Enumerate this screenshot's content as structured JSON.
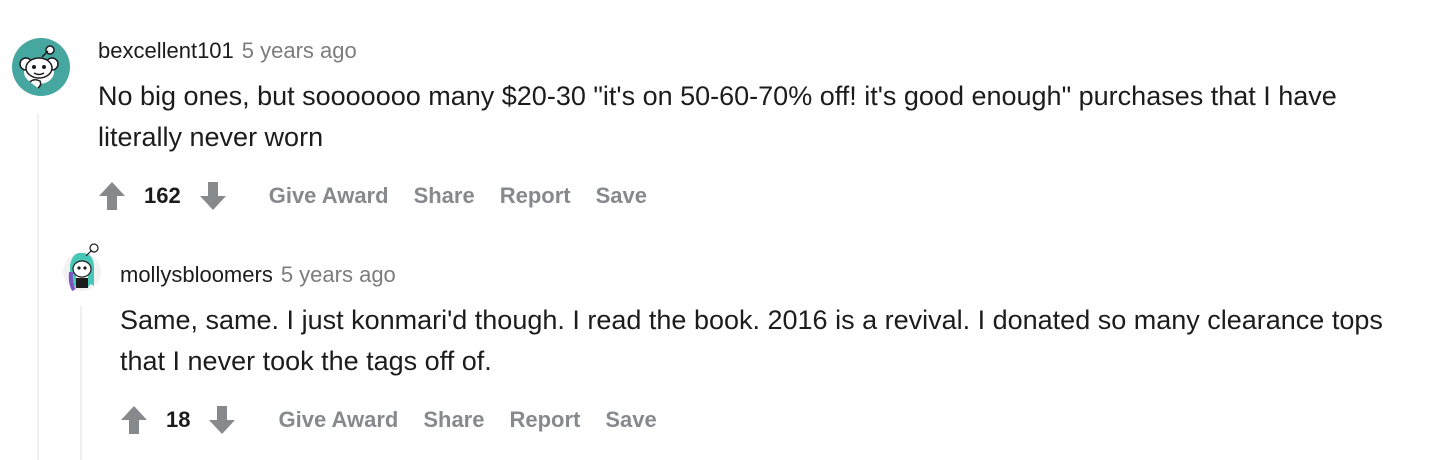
{
  "comments": [
    {
      "author": "bexcellent101",
      "time": "5 years ago",
      "body": "No big ones, but sooooooo many $20-30 \"it's on 50-60-70% off! it's good enough\" purchases that I have literally never worn",
      "score": "162",
      "actions": {
        "give_award": "Give Award",
        "share": "Share",
        "report": "Report",
        "save": "Save"
      },
      "avatar_icon": "snoo-avatar-icon"
    },
    {
      "author": "mollysbloomers",
      "time": "5 years ago",
      "body": "Same, same. I just konmari'd though. I read the book. 2016 is a revival. I donated so many clearance tops that I never took the tags off of.",
      "score": "18",
      "actions": {
        "give_award": "Give Award",
        "share": "Share",
        "report": "Report",
        "save": "Save"
      },
      "avatar_icon": "snoo-avatar-icon"
    }
  ],
  "colors": {
    "accent_avatar_1": "#46a7a0",
    "accent_avatar_2": "#7e53c1",
    "action_text": "#878a8c",
    "thread_line": "#edeff1"
  }
}
